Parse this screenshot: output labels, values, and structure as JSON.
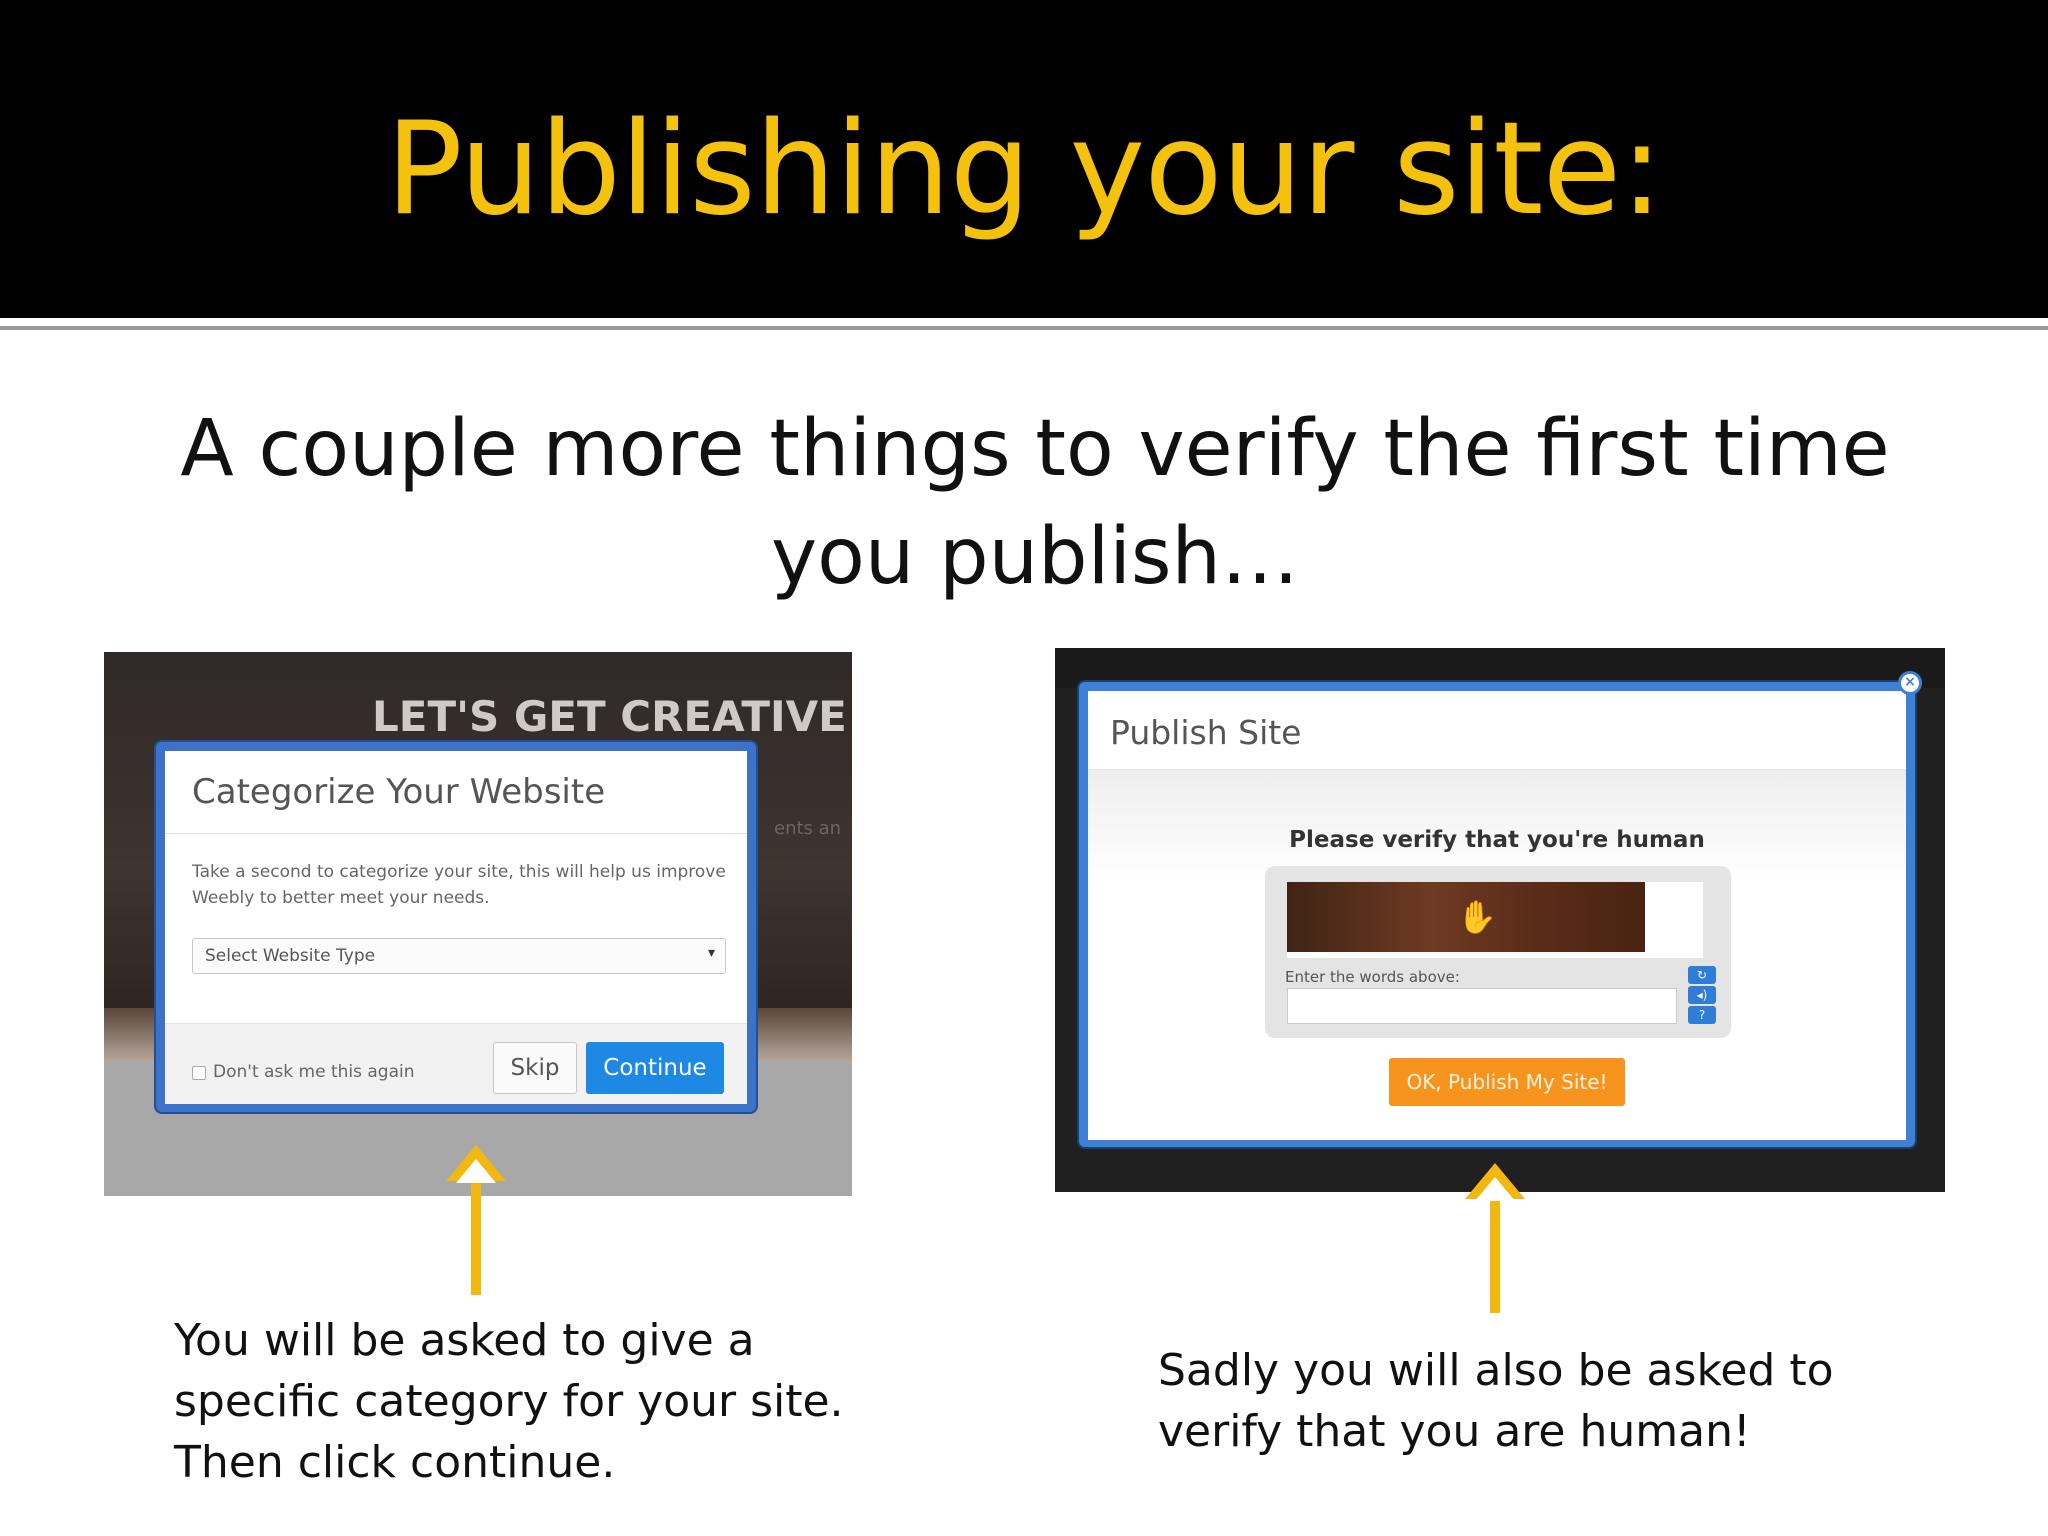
{
  "slide": {
    "title": "Publishing your site:",
    "subtitle": "A couple more things to verify the first time you publish…",
    "colors": {
      "title_bar": "#000000",
      "title_text": "#f4c20d",
      "arrow": "#f2b80f"
    }
  },
  "left_screenshot": {
    "background_title": "LET'S GET CREATIVE",
    "background_snippet": "ents an",
    "dialog": {
      "title": "Categorize Your Website",
      "description": "Take a second to categorize your site, this will help us improve Weebly to better meet your needs.",
      "select_placeholder": "Select Website Type",
      "checkbox_label": "Don't ask me this again",
      "skip_label": "Skip",
      "continue_label": "Continue"
    },
    "caption": "You will be asked to give a specific category for your site. Then click continue."
  },
  "right_screenshot": {
    "dialog": {
      "title": "Publish Site",
      "heading": "Please verify that you're human",
      "captcha_label": "Enter the words above:",
      "publish_label": "OK, Publish My Site!",
      "close_icon": "close-icon",
      "colors": {
        "border": "#3d80d6",
        "publish_button": "#f7941d"
      }
    },
    "caption": "Sadly you will also be asked to verify that you are human!"
  },
  "icons": [
    "arrow-up-icon",
    "close-icon",
    "chevron-down-icon",
    "refresh-icon",
    "audio-icon",
    "help-icon"
  ]
}
